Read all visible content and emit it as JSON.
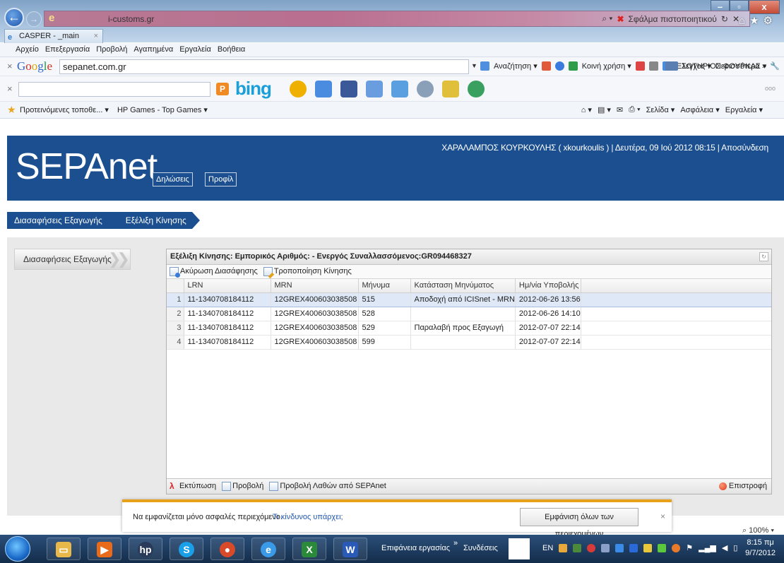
{
  "browser": {
    "url_host": "i-customs.gr",
    "cert_error": "Σφάλμα πιστοποιητικού",
    "tab_title": "CASPER - _main",
    "menu": [
      "Αρχείο",
      "Επεξεργασία",
      "Προβολή",
      "Αγαπημένα",
      "Εργαλεία",
      "Βοήθεια"
    ],
    "google_query": "sepanet.com.gr",
    "google_tools": [
      "Αναζήτηση ▾",
      "Κοινή χρήση ▾",
      "Έλεγχος ▾",
      "Περισσότερα »"
    ],
    "google_user": "ΣΩΤΗΡΙΟΣ ΦΟΥΡΚΑΣ ▾",
    "bing_logo": "bing",
    "bing_more": "ooo",
    "favorites": [
      "Προτεινόμενες τοποθε... ▾",
      "HP Games - Top Games ▾"
    ],
    "command_bar": [
      "Σελίδα ▾",
      "Ασφάλεια ▾",
      "Εργαλεία ▾"
    ],
    "zoom": "100%"
  },
  "app": {
    "logo": "SEPAnet",
    "nav": {
      "declarations": "Δηλώσεις",
      "profile": "Προφίλ"
    },
    "user_line": "ΧΑΡΑΛΑΜΠΟΣ ΚΟΥΡΚΟΥΛΗΣ ( xkourkoulis ) | Δευτέρα, 09 Ιού 2012 08:15 | Αποσύνδεση",
    "breadcrumb": [
      "Διασαφήσεις Εξαγωγής",
      "Εξέλιξη Κίνησης"
    ],
    "side_menu": "Διασαφήσεις Εξαγωγής",
    "panel": {
      "title": "Εξέλιξη Κίνησης: Εμπορικός Αριθμός: - Ενεργός Συναλλασσόμενος:GR094468327",
      "toolbar": {
        "cancel": "Ακύρωση Διασάφησης",
        "modify": "Τροποποίηση Κίνησης"
      },
      "columns": [
        "LRN",
        "MRN",
        "Μήνυμα",
        "Κατάσταση Μηνύματος",
        "Ημ/νία Υποβολής"
      ],
      "rows": [
        {
          "n": "1",
          "lrn": "11-1340708184112",
          "mrn": "12GREX400603038508",
          "msg": "515",
          "status": "Αποδοχή από ICISnet - MRN",
          "date": "2012-06-26 13:56"
        },
        {
          "n": "2",
          "lrn": "11-1340708184112",
          "mrn": "12GREX400603038508",
          "msg": "528",
          "status": "",
          "date": "2012-06-26 14:10"
        },
        {
          "n": "3",
          "lrn": "11-1340708184112",
          "mrn": "12GREX400603038508",
          "msg": "529",
          "status": "Παραλαβή προς Εξαγωγή",
          "date": "2012-07-07 22:14"
        },
        {
          "n": "4",
          "lrn": "11-1340708184112",
          "mrn": "12GREX400603038508",
          "msg": "599",
          "status": "",
          "date": "2012-07-07 22:14"
        }
      ],
      "footer": {
        "print": "Εκτύπωση",
        "view": "Προβολή",
        "view_errors": "Προβολή Λαθών από SEPAnet",
        "back": "Επιστροφή"
      }
    }
  },
  "notice": {
    "text": "Να εμφανίζεται μόνο ασφαλές περιεχόμενο.",
    "link": "Τι κίνδυνος υπάρχει;",
    "button": "Εμφάνιση όλων των περιεχομένων"
  },
  "taskbar": {
    "desktop": "Επιφάνεια εργασίας",
    "more": "»",
    "links": "Συνδέσεις",
    "lang": "EN",
    "time": "8:15 πμ",
    "date": "9/7/2012"
  },
  "colors": {
    "header_blue": "#1b4f8f",
    "notice_orange": "#e8a21a",
    "selection": "#dfe8f6"
  }
}
